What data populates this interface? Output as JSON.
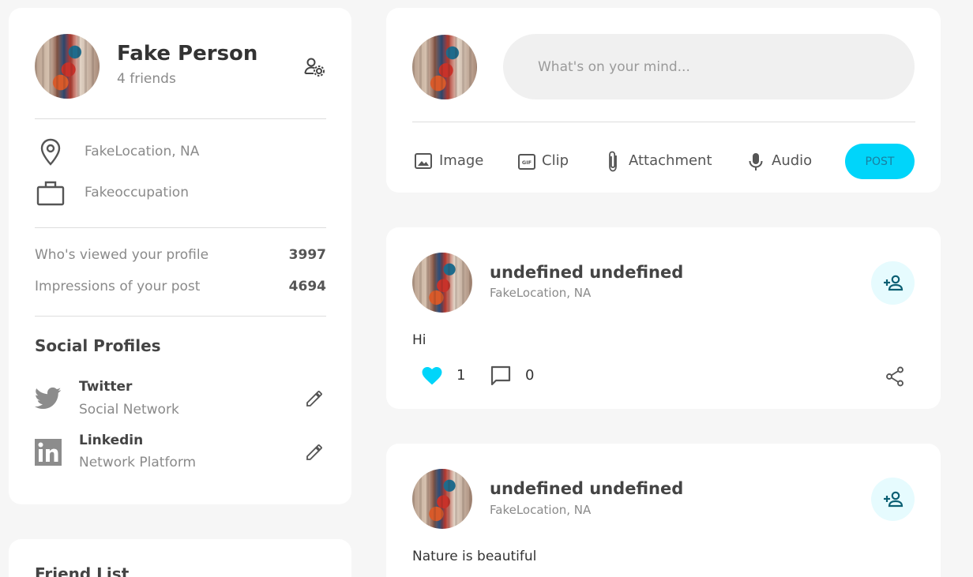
{
  "profile": {
    "name": "Fake Person",
    "friends": "4 friends",
    "location": "FakeLocation, NA",
    "occupation": "Fakeoccupation",
    "stats": [
      {
        "label": "Who's viewed your profile",
        "value": "3997"
      },
      {
        "label": "Impressions of your post",
        "value": "4694"
      }
    ],
    "social_title": "Social Profiles",
    "social": [
      {
        "name": "Twitter",
        "type": "Social Network",
        "icon": "twitter-icon"
      },
      {
        "name": "Linkedin",
        "type": "Network Platform",
        "icon": "linkedin-icon"
      }
    ]
  },
  "friend_list": {
    "title": "Friend List"
  },
  "composer": {
    "placeholder": "What's on your mind...",
    "actions": [
      {
        "label": "Image",
        "icon": "image-icon"
      },
      {
        "label": "Clip",
        "icon": "gif-icon"
      },
      {
        "label": "Attachment",
        "icon": "paperclip-icon"
      },
      {
        "label": "Audio",
        "icon": "microphone-icon"
      }
    ],
    "post_label": "POST"
  },
  "posts": [
    {
      "author": "undefined undefined",
      "location": "FakeLocation, NA",
      "text": "Hi",
      "likes": "1",
      "comments": "0"
    },
    {
      "author": "undefined undefined",
      "location": "FakeLocation, NA",
      "text": "Nature is beautiful"
    }
  ],
  "colors": {
    "accent": "#00d5fa",
    "like": "#00d5fa",
    "background": "#f6f6f6",
    "card": "#ffffff"
  }
}
